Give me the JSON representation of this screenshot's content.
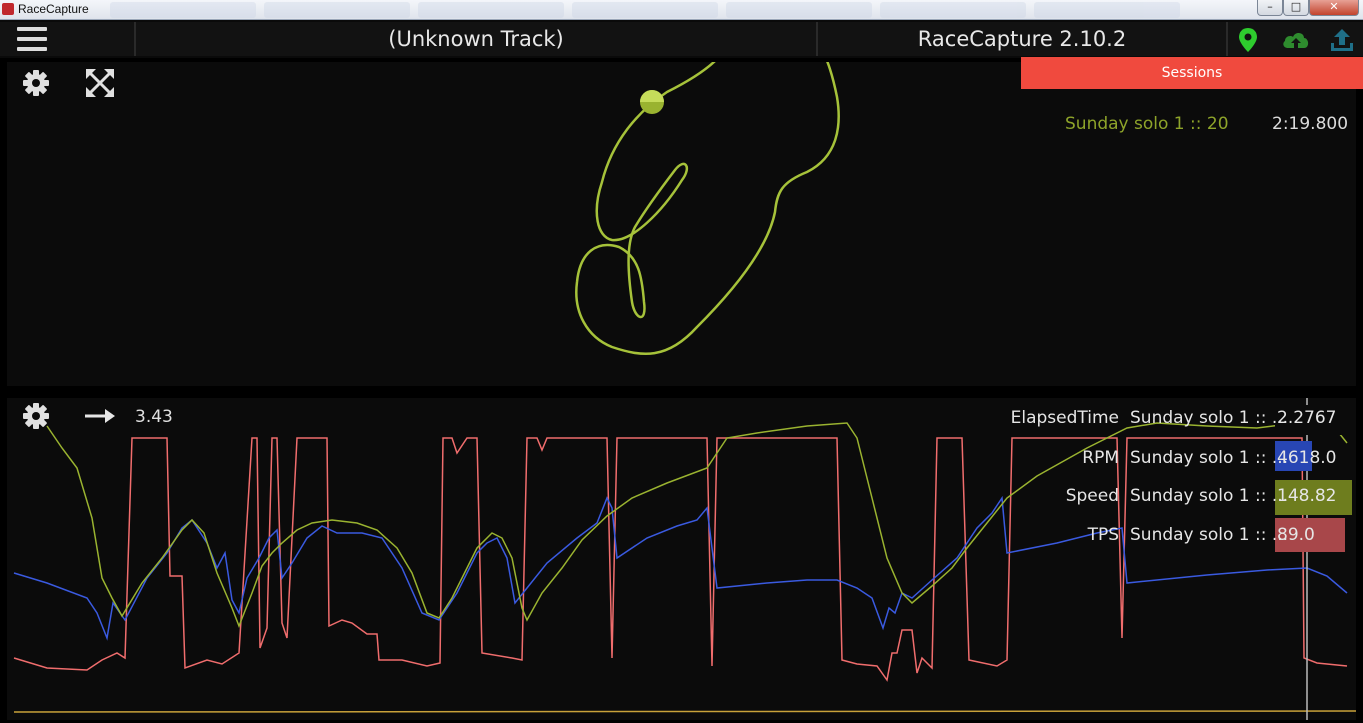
{
  "window": {
    "title": "RaceCapture",
    "controls": {
      "minimize": "–",
      "maximize": "□",
      "close": "✕"
    }
  },
  "header": {
    "menu_icon": "hamburger-menu-icon",
    "track_name": "(Unknown Track)",
    "app_version": "RaceCapture 2.10.2",
    "status_icons": [
      {
        "name": "gps-location-icon",
        "color": "#2ecc2e"
      },
      {
        "name": "cloud-upload-icon",
        "color": "#2e8b2e"
      },
      {
        "name": "upload-icon",
        "color": "#1f6f88"
      }
    ]
  },
  "track_view": {
    "sessions_button": "Sessions",
    "lap": {
      "name": "Sunday solo 1 :: 20",
      "time": "2:19.800",
      "color": "#8ea42a"
    },
    "track_color": "#a6c23a"
  },
  "chart_view": {
    "zoom_icon": "arrow-right-icon",
    "zoom_value": "3.43",
    "legend": [
      {
        "channel": "ElapsedTime",
        "session": "Sunday solo 1 :: ...",
        "value": "2.2767",
        "color": "#0b0b0b"
      },
      {
        "channel": "RPM",
        "session": "Sunday solo 1 :: ...",
        "value": "4618.0",
        "color": "#2846b4"
      },
      {
        "channel": "Speed",
        "session": "Sunday solo 1 :: ...",
        "value": "148.82",
        "color": "#6e7d1e"
      },
      {
        "channel": "TPS",
        "session": "Sunday solo 1 :: ...",
        "value": "89.0",
        "color": "#a8474a"
      }
    ],
    "series_colors": {
      "rpm": "#3a5ae0",
      "speed": "#9ab330",
      "tps": "#f06d6d",
      "elapsed": "#c9a23a"
    }
  }
}
